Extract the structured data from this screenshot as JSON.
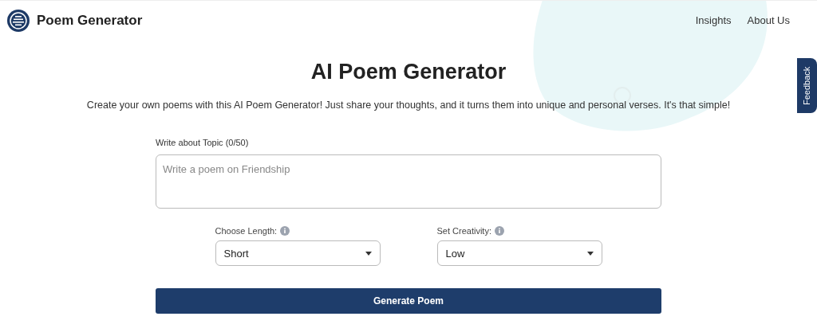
{
  "header": {
    "brand": "Poem Generator",
    "nav": [
      "Insights",
      "About Us"
    ]
  },
  "feedback_tab": "Feedback",
  "title": "AI Poem Generator",
  "subtitle": "Create your own poems with this AI Poem Generator! Just share your thoughts, and it turns them into unique and personal verses. It's that simple!",
  "topic": {
    "label": "Write about Topic (0/50)",
    "placeholder": "Write a poem on Friendship"
  },
  "selects": [
    {
      "label": "Choose Length:",
      "value": "Short"
    },
    {
      "label": "Set Creativity:",
      "value": "Low"
    }
  ],
  "button": "Generate Poem"
}
